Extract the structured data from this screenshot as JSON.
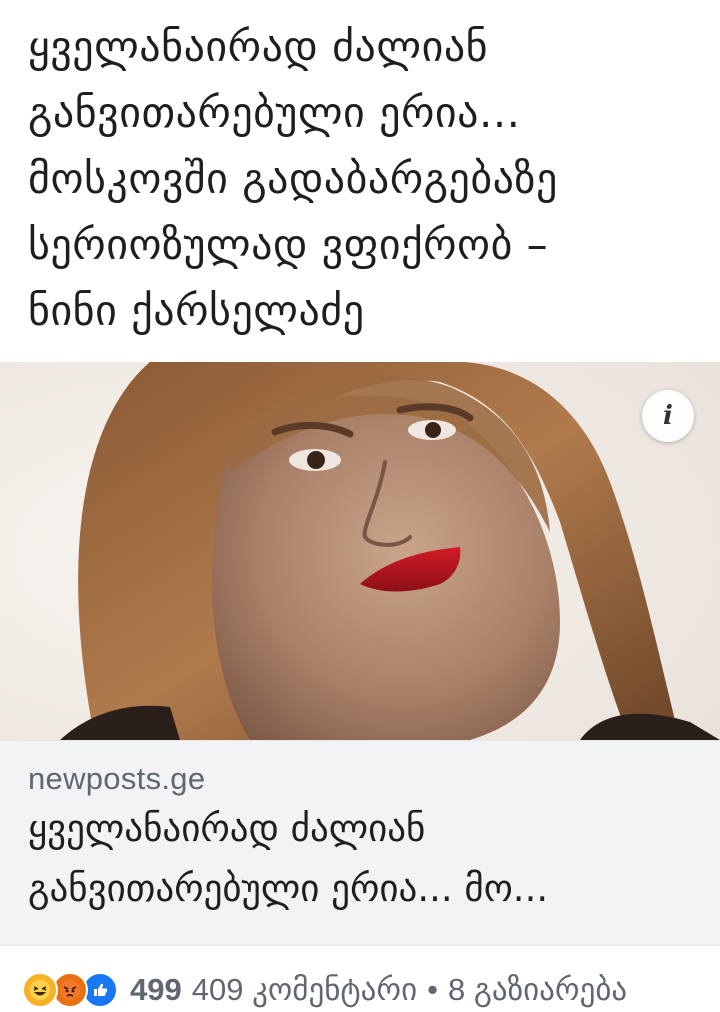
{
  "post": {
    "text": "ყველანაირად ძალიან\nგანვითარებული ერია...\nმოსკოვში გადაბარგებაზე\nსერიოზულად ვფიქრობ –\nნინი ქარსელაძე"
  },
  "link_preview": {
    "domain": "newposts.ge",
    "title": "ყველანაირად ძალიან\nგანვითარებული ერია... მო...",
    "info_icon": "info-icon"
  },
  "stats": {
    "reaction_icons": [
      "haha-reaction-icon",
      "angry-reaction-icon",
      "like-reaction-icon"
    ],
    "reaction_count": "499",
    "comments": "409 კომენტარი",
    "separator": "•",
    "shares": "8 გაზიარება"
  },
  "colors": {
    "text": "#1c1e21",
    "secondary": "#606770",
    "card_bg": "#f2f3f5",
    "like": "#1877f2",
    "angry": "#e9710f",
    "haha": "#f7b125"
  }
}
